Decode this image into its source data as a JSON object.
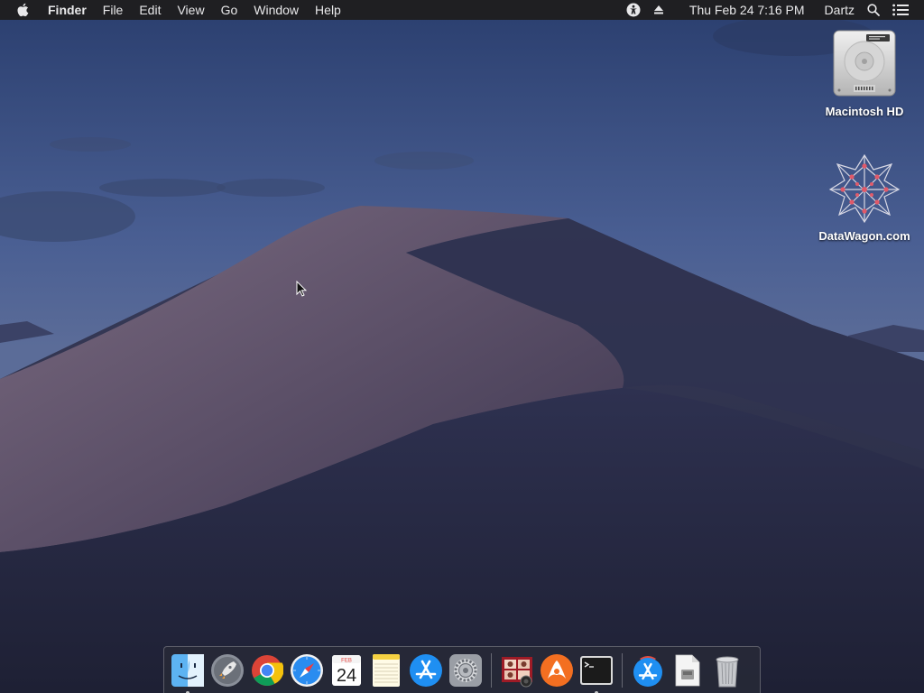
{
  "menubar": {
    "app_name": "Finder",
    "menus": [
      "File",
      "Edit",
      "View",
      "Go",
      "Window",
      "Help"
    ],
    "status_icons": [
      "accessibility-icon",
      "eject-icon"
    ],
    "datetime": "Thu Feb 24  7:16 PM",
    "user": "Dartz",
    "right_icons": [
      "spotlight-search-icon",
      "notification-center-icon"
    ]
  },
  "desktop": {
    "icons": [
      {
        "label": "Macintosh HD",
        "icon": "hard-drive-icon"
      },
      {
        "label": "DataWagon.com",
        "icon": "datawagon-network-icon"
      }
    ]
  },
  "dock": {
    "apps": [
      {
        "icon": "finder-icon",
        "running": true
      },
      {
        "icon": "launchpad-icon",
        "running": false
      },
      {
        "icon": "chrome-icon",
        "running": false
      },
      {
        "icon": "safari-icon",
        "running": false
      },
      {
        "icon": "calendar-icon",
        "running": false,
        "month": "FEB",
        "day": "24"
      },
      {
        "icon": "notes-icon",
        "running": false
      },
      {
        "icon": "app-store-icon",
        "running": false
      },
      {
        "icon": "system-preferences-icon",
        "running": false
      },
      {
        "icon": "photo-booth-icon",
        "running": false
      },
      {
        "icon": "avast-icon",
        "running": false
      },
      {
        "icon": "terminal-icon",
        "running": true
      },
      {
        "icon": "app-store-downloads-icon",
        "running": false
      },
      {
        "icon": "documents-stack-icon",
        "running": false
      },
      {
        "icon": "trash-icon",
        "running": false
      }
    ]
  },
  "colors": {
    "menubar_bg": "#1f1f22",
    "sky_top": "#2b3f6e",
    "dune_light": "#6b5f78",
    "dune_dark": "#262a42"
  }
}
